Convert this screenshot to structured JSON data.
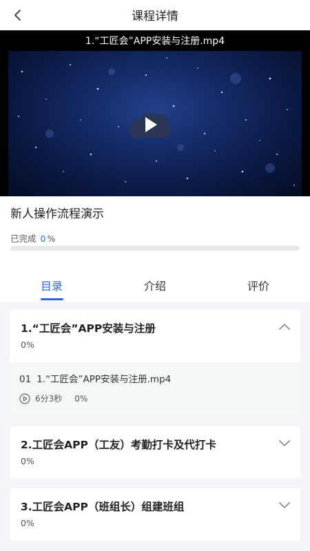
{
  "header": {
    "title": "课程详情",
    "back_icon": "chevron-left-icon"
  },
  "player": {
    "video_title": "1.“工匠会”APP安装与注册.mp4",
    "play_icon": "cloud-play-icon"
  },
  "course": {
    "title": "新人操作流程演示",
    "progress_label": "已完成",
    "progress_value": "0",
    "progress_unit": "%",
    "progress_fraction": 0
  },
  "tabs": [
    {
      "label": "目录",
      "active": true
    },
    {
      "label": "介绍",
      "active": false
    },
    {
      "label": "评价",
      "active": false
    }
  ],
  "chapters": [
    {
      "title": "1.“工匠会”APP安装与注册",
      "progress": "0%",
      "expanded": true,
      "lessons": [
        {
          "index": "01",
          "title": "1.“工匠会”APP安装与注册.mp4",
          "duration": "6分3秒",
          "progress": "0%"
        }
      ]
    },
    {
      "title": "2.工匠会APP（工友）考勤打卡及代打卡",
      "progress": "0%",
      "expanded": false
    },
    {
      "title": "3.工匠会APP（班组长）组建班组",
      "progress": "0%",
      "expanded": false
    }
  ],
  "colors": {
    "accent": "#2a64d8",
    "lesson_bg": "#f2f8f5",
    "content_bg": "#f3f5f8"
  }
}
